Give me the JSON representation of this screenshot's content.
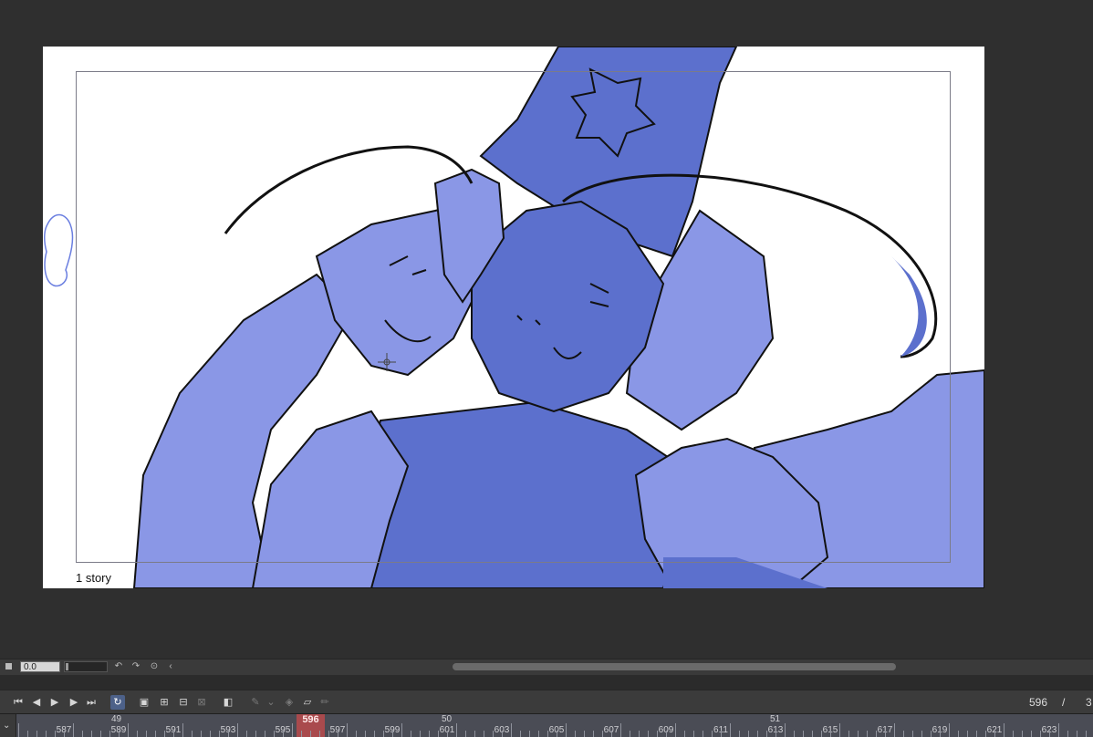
{
  "canvas": {
    "story_label": "1 story",
    "colors": {
      "fill_light": "#8a97e6",
      "fill_dark": "#5c70cd",
      "line": "#111111",
      "paper": "#ffffff",
      "workspace": "#2f2f2f"
    }
  },
  "zoom_bar": {
    "value": "0.0"
  },
  "timeline": {
    "current_frame": "596",
    "frame_separator": "/",
    "total_frames": "3",
    "page_markers": [
      "49",
      "50",
      "51"
    ],
    "ruler_labels": [
      "587",
      "589",
      "591",
      "593",
      "595",
      "597",
      "599",
      "601",
      "603",
      "605",
      "607",
      "609",
      "611",
      "613",
      "615",
      "617",
      "619",
      "621",
      "623"
    ],
    "playhead_label": "596",
    "playhead_color": "#a94a4d"
  },
  "toolbar_icons": [
    "first-frame-icon",
    "prev-frame-icon",
    "play-icon",
    "next-frame-icon",
    "last-frame-icon",
    "loop-icon",
    "new-cel-icon",
    "add-cel-icon",
    "cel-options-icon",
    "delete-cel-icon",
    "onion-skin-icon",
    "pen-tool-icon",
    "dropdown-icon",
    "fill-icon",
    "layer-icon",
    "pencil-icon"
  ]
}
